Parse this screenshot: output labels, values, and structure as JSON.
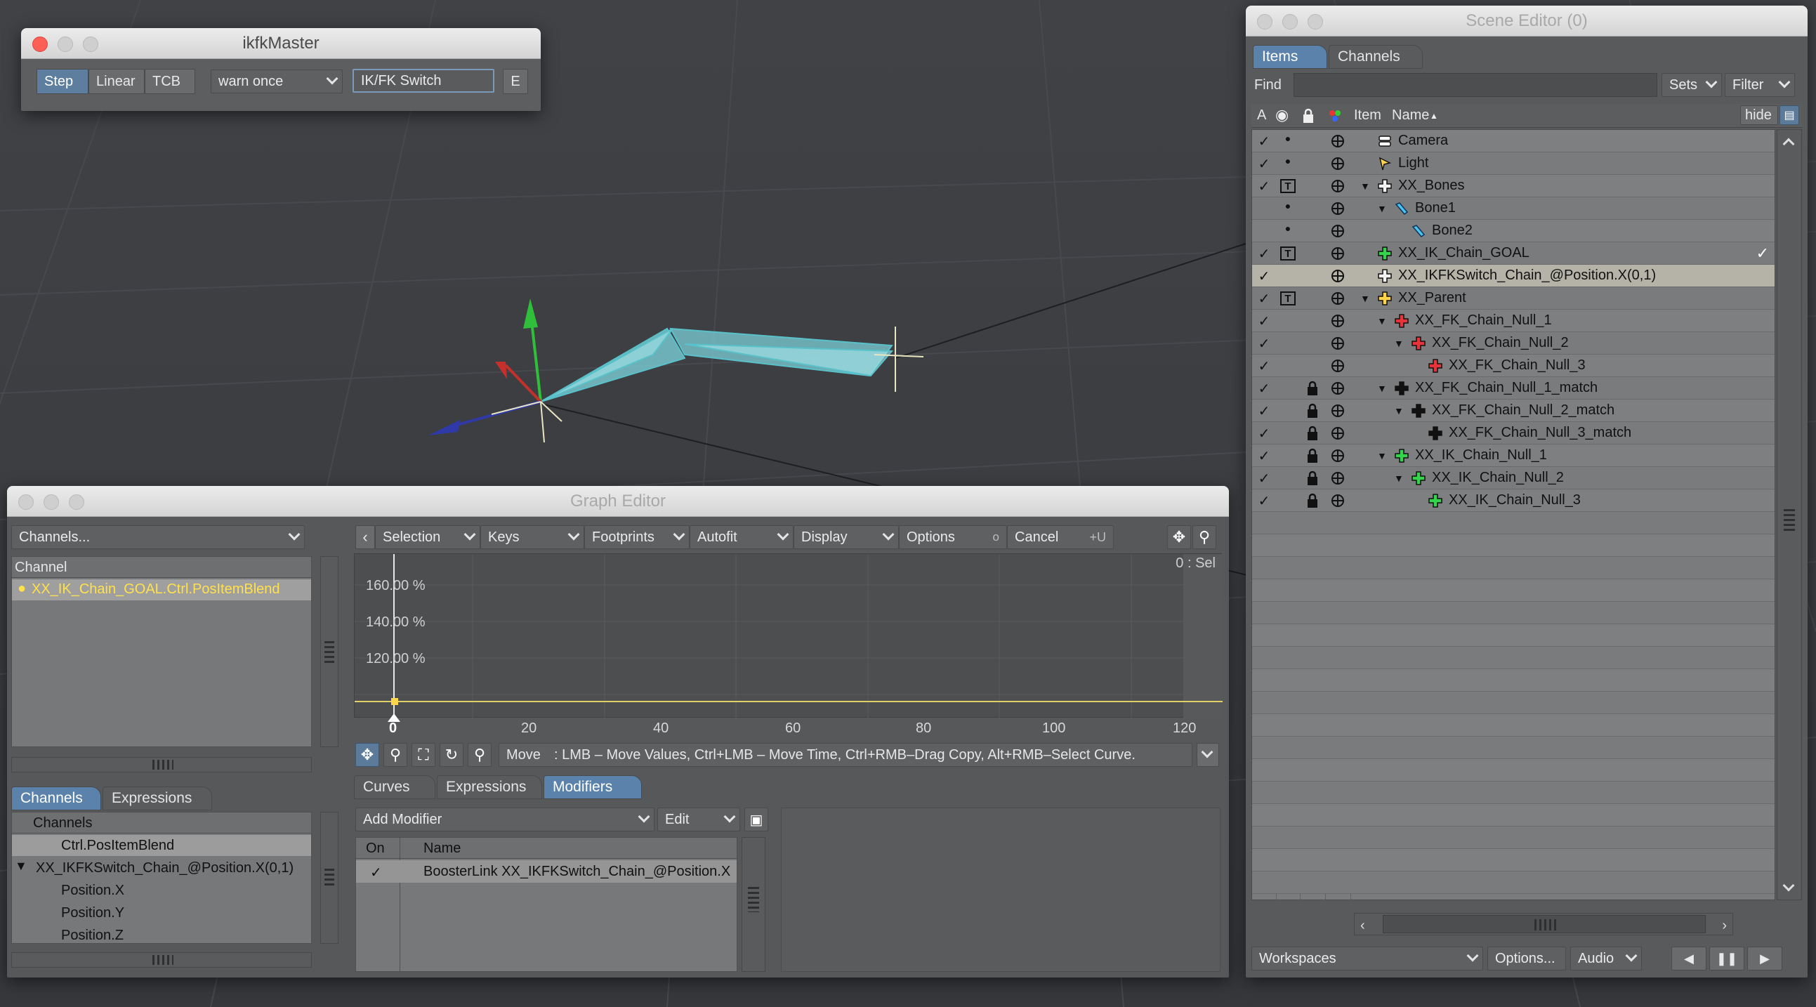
{
  "ikfk": {
    "title": "ikfkMaster",
    "step": "Step",
    "linear": "Linear",
    "tcb": "TCB",
    "warn": "warn once",
    "switch": "IK/FK Switch",
    "e": "E"
  },
  "graph": {
    "title": "Graph Editor",
    "channels_dd": "Channels...",
    "channel_header": "Channel",
    "selected_channel": "XX_IK_Chain_GOAL.Ctrl.PosItemBlend",
    "toolbar": {
      "selection": "Selection",
      "keys": "Keys",
      "footprints": "Footprints",
      "autofit": "Autofit",
      "display": "Display",
      "options": "Options",
      "o": "o",
      "cancel": "Cancel",
      "u": "+U"
    },
    "sel_label": "0 : Sel",
    "y_ticks": [
      "160.00 %",
      "140.00 %",
      "120.00 %"
    ],
    "x_ticks": [
      "0",
      "20",
      "40",
      "60",
      "80",
      "100",
      "120"
    ],
    "move_label": "Move",
    "move_help": ":  LMB – Move Values, Ctrl+LMB – Move Time, Ctrl+RMB–Drag Copy, Alt+RMB–Select Curve.",
    "bottom_tabs": [
      "Curves",
      "Expressions",
      "Modifiers"
    ],
    "add_modifier": "Add Modifier",
    "edit": "Edit",
    "mod_cols": {
      "on": "On",
      "name": "Name"
    },
    "mod_check": "✓",
    "mod_row": "BoosterLink XX_IKFKSwitch_Chain_@Position.X",
    "left_tabs": [
      "Channels",
      "Expressions"
    ],
    "tree": {
      "root": "Channels",
      "items": [
        "Ctrl.PosItemBlend",
        "XX_IKFKSwitch_Chain_@Position.X(0,1)",
        "Position.X",
        "Position.Y",
        "Position.Z"
      ]
    }
  },
  "scene": {
    "title": "Scene Editor (0)",
    "tabs": [
      "Items",
      "Channels"
    ],
    "find": "Find",
    "sets": "Sets",
    "filter": "Filter",
    "cols": {
      "a": "A",
      "item": "Item",
      "name": "Name"
    },
    "hide": "hide",
    "rows": [
      {
        "a": "✓",
        "vis": "●",
        "t": false,
        "lock": false,
        "indent": 0,
        "arrow": "",
        "name": "Camera",
        "color": "#ffffff",
        "type": "camera"
      },
      {
        "a": "✓",
        "vis": "●",
        "t": false,
        "lock": false,
        "indent": 0,
        "arrow": "",
        "name": "Light",
        "color": "#ffd34a",
        "type": "light"
      },
      {
        "a": "✓",
        "vis": "",
        "t": true,
        "lock": false,
        "indent": 0,
        "arrow": "▼",
        "name": "XX_Bones",
        "color": "#f2f2f2",
        "type": "null"
      },
      {
        "a": "",
        "vis": "●",
        "t": false,
        "lock": false,
        "indent": 1,
        "arrow": "▼",
        "name": "Bone1",
        "color": "#49c3f0",
        "type": "bone"
      },
      {
        "a": "",
        "vis": "●",
        "t": false,
        "lock": false,
        "indent": 2,
        "arrow": "",
        "name": "Bone2",
        "color": "#49c3f0",
        "type": "bone"
      },
      {
        "a": "✓",
        "vis": "",
        "t": true,
        "lock": false,
        "indent": 0,
        "arrow": "",
        "name": "XX_IK_Chain_GOAL",
        "color": "#35d24b",
        "type": "null",
        "check": "✓"
      },
      {
        "a": "✓",
        "vis": "",
        "t": false,
        "lock": false,
        "indent": 0,
        "arrow": "",
        "name": "XX_IKFKSwitch_Chain_@Position.X(0,1)",
        "color": "#f2f2f2",
        "type": "null",
        "selected": true
      },
      {
        "a": "✓",
        "vis": "",
        "t": true,
        "lock": false,
        "indent": 0,
        "arrow": "▼",
        "name": "XX_Parent",
        "color": "#ffd34a",
        "type": "null"
      },
      {
        "a": "✓",
        "vis": "",
        "t": false,
        "lock": false,
        "indent": 1,
        "arrow": "▼",
        "name": "XX_FK_Chain_Null_1",
        "color": "#e8333a",
        "type": "null"
      },
      {
        "a": "✓",
        "vis": "",
        "t": false,
        "lock": false,
        "indent": 2,
        "arrow": "▼",
        "name": "XX_FK_Chain_Null_2",
        "color": "#e8333a",
        "type": "null"
      },
      {
        "a": "✓",
        "vis": "",
        "t": false,
        "lock": false,
        "indent": 3,
        "arrow": "",
        "name": "XX_FK_Chain_Null_3",
        "color": "#e8333a",
        "type": "null"
      },
      {
        "a": "✓",
        "vis": "",
        "t": false,
        "lock": true,
        "indent": 1,
        "arrow": "▼",
        "name": "XX_FK_Chain_Null_1_match",
        "color": "#111111",
        "type": "null"
      },
      {
        "a": "✓",
        "vis": "",
        "t": false,
        "lock": true,
        "indent": 2,
        "arrow": "▼",
        "name": "XX_FK_Chain_Null_2_match",
        "color": "#111111",
        "type": "null"
      },
      {
        "a": "✓",
        "vis": "",
        "t": false,
        "lock": true,
        "indent": 3,
        "arrow": "",
        "name": "XX_FK_Chain_Null_3_match",
        "color": "#111111",
        "type": "null"
      },
      {
        "a": "✓",
        "vis": "",
        "t": false,
        "lock": true,
        "indent": 1,
        "arrow": "▼",
        "name": "XX_IK_Chain_Null_1",
        "color": "#35d24b",
        "type": "null"
      },
      {
        "a": "✓",
        "vis": "",
        "t": false,
        "lock": true,
        "indent": 2,
        "arrow": "▼",
        "name": "XX_IK_Chain_Null_2",
        "color": "#35d24b",
        "type": "null"
      },
      {
        "a": "✓",
        "vis": "",
        "t": false,
        "lock": true,
        "indent": 3,
        "arrow": "",
        "name": "XX_IK_Chain_Null_3",
        "color": "#35d24b",
        "type": "null"
      }
    ],
    "workspaces": "Workspaces",
    "options": "Options...",
    "audio": "Audio"
  }
}
